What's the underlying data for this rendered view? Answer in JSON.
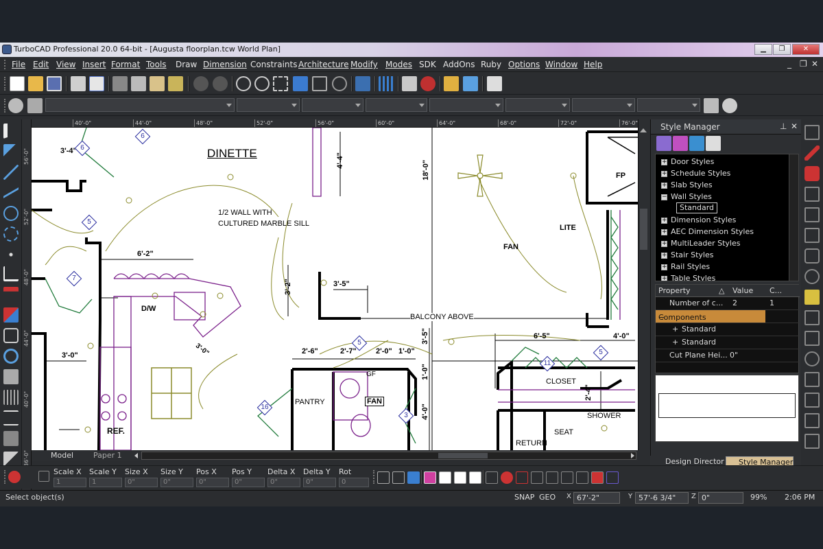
{
  "window": {
    "title": "TurboCAD Professional 20.0 64-bit - [Augusta floorplan.tcw World Plan]",
    "controls": {
      "minimize": "▁",
      "restore": "❐",
      "close": "✕"
    }
  },
  "menu": [
    "File",
    "Edit",
    "View",
    "Insert",
    "Format",
    "Tools",
    "Draw",
    "Dimension",
    "Constraints",
    "Architecture",
    "Modify",
    "Modes",
    "SDK",
    "AddOns",
    "Ruby",
    "Options",
    "Window",
    "Help"
  ],
  "mdi_controls": {
    "minimize": "_",
    "restore": "❐",
    "close": "✕"
  },
  "ruler": {
    "horizontal": [
      "40'-0\"",
      "44'-0\"",
      "48'-0\"",
      "52'-0\"",
      "56'-0\"",
      "60'-0\"",
      "64'-0\"",
      "68'-0\"",
      "72'-0\"",
      "76'-0\""
    ],
    "vertical": [
      "56'-0\"",
      "52'-0\"",
      "48'-0\"",
      "44'-0\"",
      "40'-0\"",
      "36'-0\""
    ]
  },
  "drawing": {
    "rooms": {
      "dinette": "DINETTE",
      "balcony": "BALCONY ABOVE",
      "pantry": "PANTRY",
      "closet": "CLOSET",
      "shower": "SHOWER",
      "seat": "SEAT",
      "return": "RETURN",
      "ref": "REF.",
      "dw": "D/W",
      "fp": "FP",
      "gf": "GF",
      "fan_small": "FAN",
      "fan": "FAN",
      "lite": "LITE"
    },
    "note_line1": "1/2 WALL WITH",
    "note_line2": "CULTURED MARBLE SILL",
    "dims": {
      "d1": "3'-4\"",
      "d2": "6'-2\"",
      "d3": "3'-0\"",
      "d4": "3'-0\"",
      "d5": "4'-4\"",
      "d6": "18'-0\"",
      "d7": "3'-2\"",
      "d8": "3'-5\"",
      "d9": "2'-6\"",
      "d10": "2'-7\"",
      "d11": "2'-0\"",
      "d12": "1'-0\"",
      "d13": "3'-5\"",
      "d14": "1'-0\"",
      "d15": "4'-0\"",
      "d16": "6'-5\"",
      "d17": "4'-0\"",
      "d18": "2'-4\""
    },
    "tags": [
      "6",
      "6",
      "5",
      "7",
      "5",
      "16",
      "3",
      "11",
      "5"
    ],
    "switch_3": "3"
  },
  "tabs": {
    "model": "Model",
    "paper": "Paper 1"
  },
  "style_manager": {
    "title": "Style Manager",
    "pin": "⊥",
    "close": "✕",
    "tree": [
      {
        "label": "Door Styles",
        "expander": "+"
      },
      {
        "label": "Schedule Styles",
        "expander": "+"
      },
      {
        "label": "Slab Styles",
        "expander": "+"
      },
      {
        "label": "Wall Styles",
        "expander": "−"
      },
      {
        "label": "Dimension Styles",
        "expander": "+"
      },
      {
        "label": "AEC Dimension Styles",
        "expander": "+"
      },
      {
        "label": "MultiLeader Styles",
        "expander": "+"
      },
      {
        "label": "Stair Styles",
        "expander": "+"
      },
      {
        "label": "Rail Styles",
        "expander": "+"
      },
      {
        "label": "Table Styles",
        "expander": "+"
      }
    ],
    "selected_child": "Standard",
    "props_header": {
      "property": "Property",
      "sort": "△",
      "value": "Value",
      "c": "C..."
    },
    "props_rows": [
      {
        "name": "Number of c...",
        "value": "2",
        "c": "1",
        "expander": ""
      },
      {
        "name": "Components",
        "value": "",
        "c": "",
        "expander": "−"
      },
      {
        "name": "Standard",
        "value": "",
        "c": "",
        "expander": "+"
      },
      {
        "name": "Standard",
        "value": "",
        "c": "",
        "expander": "+"
      },
      {
        "name": "Cut Plane Hei...",
        "value": "0\"",
        "c": "",
        "expander": ""
      }
    ],
    "bottom_tabs": [
      "Design Director",
      "Style Manager"
    ]
  },
  "inspector": {
    "fields": [
      {
        "label": "Scale X",
        "value": "1"
      },
      {
        "label": "Scale Y",
        "value": "1"
      },
      {
        "label": "Size X",
        "value": "0\""
      },
      {
        "label": "Size Y",
        "value": "0\""
      },
      {
        "label": "Pos X",
        "value": "0\""
      },
      {
        "label": "Pos Y",
        "value": "0\""
      },
      {
        "label": "Delta X",
        "value": "0\""
      },
      {
        "label": "Delta Y",
        "value": "0\""
      },
      {
        "label": "Rot",
        "value": "0"
      }
    ]
  },
  "status": {
    "prompt": "Select object(s)",
    "snap": "SNAP",
    "geo": "GEO",
    "x": "67'-2\"",
    "y": "57'-6 3/4\"",
    "z": "0\"",
    "zoom": "99%",
    "time": "2:06 PM"
  },
  "colors": {
    "accent": "#c88a3a",
    "wall": "#000000",
    "dimension": "#000000",
    "fixture": "#7a1f8a",
    "wiring": "#8a8a2a",
    "door": "#1f7a3a",
    "tag": "#2b2fa0"
  }
}
